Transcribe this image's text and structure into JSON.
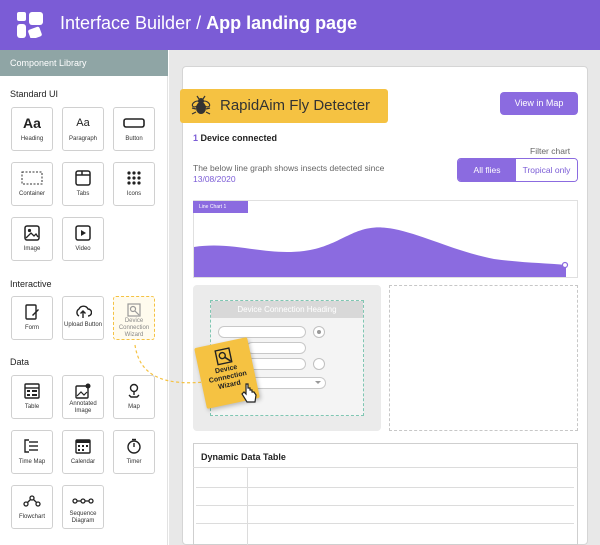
{
  "header": {
    "title_prefix": "Interface Builder / ",
    "title_page": "App landing page",
    "accent": "#7b5cd6"
  },
  "sidebar": {
    "heading": "Component Library",
    "sections": {
      "standard": "Standard UI",
      "interactive": "Interactive",
      "data": "Data"
    },
    "standard_items": [
      {
        "label": "Heading",
        "icon": "heading-icon"
      },
      {
        "label": "Paragraph",
        "icon": "paragraph-icon"
      },
      {
        "label": "Button",
        "icon": "button-icon"
      },
      {
        "label": "Container",
        "icon": "container-icon"
      },
      {
        "label": "Tabs",
        "icon": "tabs-icon"
      },
      {
        "label": "Icons",
        "icon": "icons-grid-icon"
      },
      {
        "label": "Image",
        "icon": "image-icon"
      },
      {
        "label": "Video",
        "icon": "video-icon"
      }
    ],
    "interactive_items": [
      {
        "label": "Form",
        "icon": "form-icon"
      },
      {
        "label": "Upload Button",
        "icon": "upload-icon"
      },
      {
        "label": "Device Connection Wizard",
        "icon": "wizard-icon"
      }
    ],
    "data_items": [
      {
        "label": "Table",
        "icon": "table-icon"
      },
      {
        "label": "Annotated Image",
        "icon": "annotated-image-icon"
      },
      {
        "label": "Map",
        "icon": "map-pin-icon"
      },
      {
        "label": "Time Map",
        "icon": "time-map-icon"
      },
      {
        "label": "Calendar",
        "icon": "calendar-icon"
      },
      {
        "label": "Timer",
        "icon": "timer-icon"
      },
      {
        "label": "Flowchart",
        "icon": "flowchart-icon"
      },
      {
        "label": "Sequence Diagram",
        "icon": "sequence-diagram-icon"
      }
    ],
    "icon_glyphs": {
      "heading": "Aa",
      "paragraph": "Aa"
    }
  },
  "canvas": {
    "app_title": "RapidAim Fly Detecter",
    "view_map": "View in Map",
    "device_count": "1",
    "device_text": " Device connected",
    "desc_text": "The below line graph shows insects detected since ",
    "desc_date": "13/08/2020",
    "filter_label": "Filter chart",
    "filter_all": "All flies",
    "filter_tropical": "Tropical only",
    "chart_tag": "Line Chart 1",
    "wizard_heading": "Device Connection Heading",
    "drag_label": "Device Connection Wizard",
    "table_title": "Dynamic Data Table",
    "colors": {
      "purple": "#8b6be0",
      "yellow": "#f5c242",
      "teal": "#7fc6b2"
    }
  }
}
